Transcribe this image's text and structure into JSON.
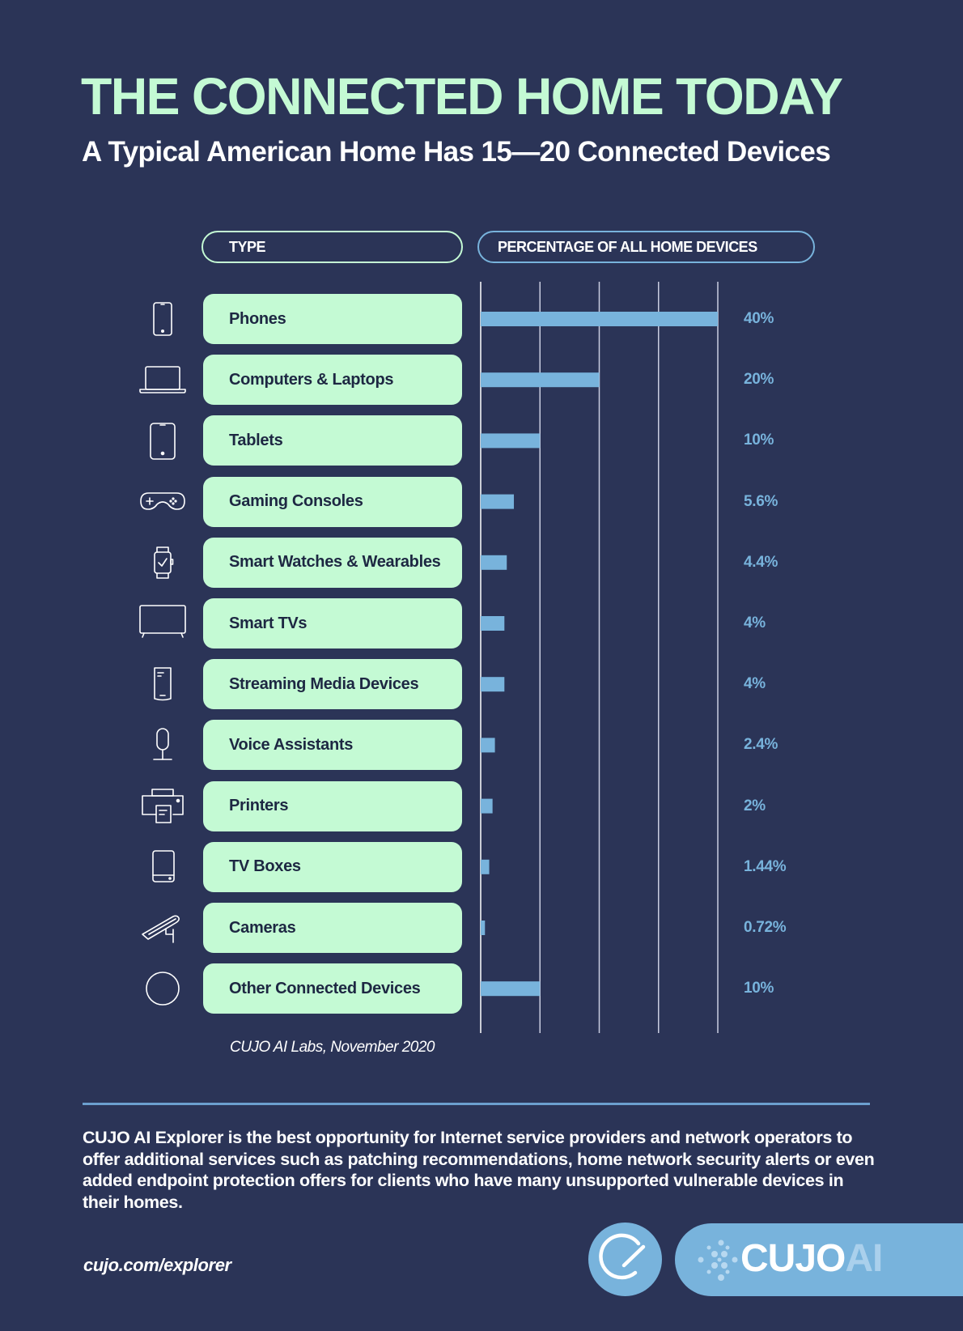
{
  "header": {
    "title": "THE CONNECTED HOME TODAY",
    "subtitle": "A Typical American Home Has 15—20 Connected Devices"
  },
  "table_headers": {
    "type": "TYPE",
    "percentage": "PERCENTAGE OF ALL HOME DEVICES"
  },
  "colors": {
    "background": "#2b3457",
    "accent_green": "#c4fad4",
    "accent_blue": "#78b3dc",
    "label_text": "#1d2742"
  },
  "chart_data": {
    "type": "bar",
    "orientation": "horizontal",
    "title": "THE CONNECTED HOME TODAY",
    "subtitle": "A Typical American Home Has 15—20 Connected Devices",
    "xlabel": "PERCENTAGE OF ALL HOME DEVICES",
    "ylabel": "TYPE",
    "xlim": [
      0,
      40
    ],
    "grid_values": [
      0,
      10,
      20,
      30,
      40
    ],
    "grid": true,
    "legend": "none",
    "categories": [
      "Phones",
      "Computers & Laptops",
      "Tablets",
      "Gaming Consoles",
      "Smart Watches & Wearables",
      "Smart TVs",
      "Streaming Media Devices",
      "Voice Assistants",
      "Printers",
      "TV Boxes",
      "Cameras",
      "Other Connected Devices"
    ],
    "values": [
      40,
      20,
      10,
      5.6,
      4.4,
      4,
      4,
      2.4,
      2,
      1.44,
      0.72,
      10
    ],
    "value_labels": [
      "40%",
      "20%",
      "10%",
      "5.6%",
      "4.4%",
      "4%",
      "4%",
      "2.4%",
      "2%",
      "1.44%",
      "0.72%",
      "10%"
    ],
    "icons": [
      "phone-icon",
      "laptop-icon",
      "tablet-icon",
      "gamepad-icon",
      "smartwatch-icon",
      "tv-icon",
      "streaming-device-icon",
      "voice-assistant-icon",
      "printer-icon",
      "tv-box-icon",
      "camera-icon",
      "circle-icon"
    ],
    "source": "CUJO AI Labs, November 2020"
  },
  "footer": {
    "body": "CUJO AI Explorer is the best opportunity for Internet service providers and network operators to offer additional services such as patching recommendations, home network security alerts or even added endpoint protection offers for clients who have many unsupported vulnerable devices in their homes.",
    "url": "cujo.com/explorer",
    "logo_word_primary": "CUJO",
    "logo_word_secondary": "AI"
  }
}
